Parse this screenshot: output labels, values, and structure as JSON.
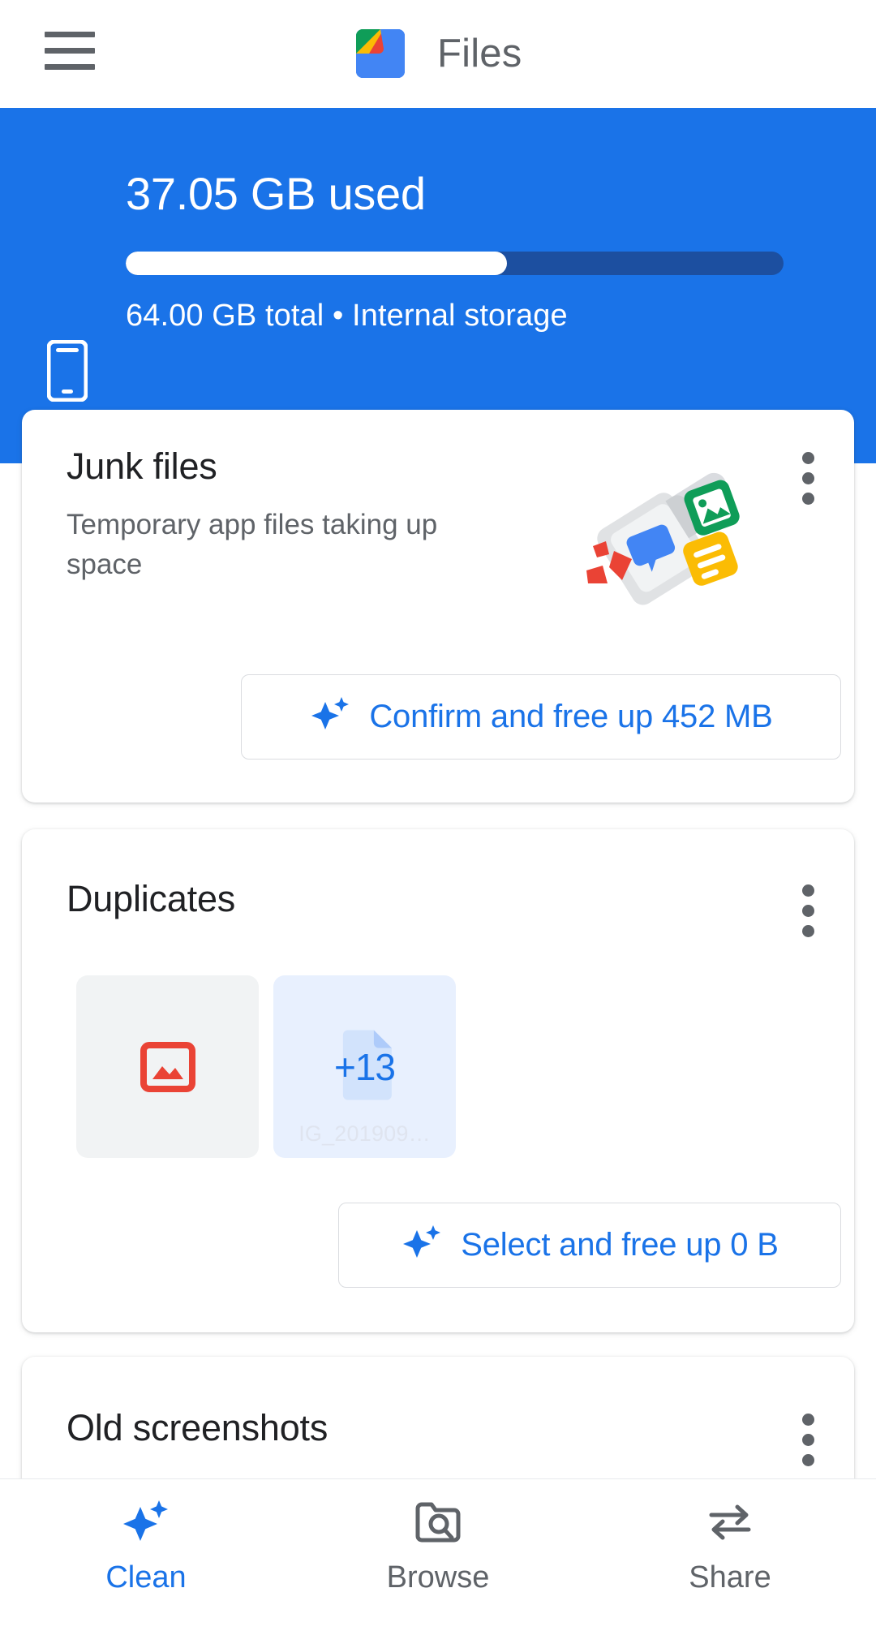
{
  "app": {
    "title": "Files",
    "accent_color": "#1a73e8",
    "banner_color": "#1a73e8",
    "muted_text_color": "#5f6368"
  },
  "appbar": {
    "menu_icon": "hamburger-menu-icon",
    "logo_icon": "files-app-logo-icon",
    "title": "Files"
  },
  "storage": {
    "device_icon": "phone-icon",
    "used_text": "37.05 GB used",
    "total_text": "64.00 GB total • Internal storage",
    "used_gb": 37.05,
    "total_gb": 64.0,
    "percent_used": 57.9
  },
  "cards": [
    {
      "id": "junk-files",
      "title": "Junk files",
      "subtitle": "Temporary app files taking up space",
      "illustration_icon": "junk-files-illustration-icon",
      "overflow_icon": "more-vert-icon",
      "action": {
        "label": "Confirm and free up 452 MB",
        "icon": "sparkle-icon",
        "size": "452 MB"
      }
    },
    {
      "id": "duplicates",
      "title": "Duplicates",
      "overflow_icon": "more-vert-icon",
      "thumbnails": [
        {
          "icon": "image-icon",
          "label": ""
        },
        {
          "icon": "file-icon",
          "count_label": "+13",
          "label": "IG_201909…"
        }
      ],
      "action": {
        "label": "Select and free up 0 B",
        "icon": "sparkle-icon",
        "size": "0 B"
      }
    },
    {
      "id": "old-screenshots",
      "title": "Old screenshots",
      "overflow_icon": "more-vert-icon"
    }
  ],
  "bottom_nav": {
    "active": "Clean",
    "items": [
      {
        "label": "Clean",
        "icon": "sparkle-icon",
        "active": true
      },
      {
        "label": "Browse",
        "icon": "folder-search-icon",
        "active": false
      },
      {
        "label": "Share",
        "icon": "transfer-arrows-icon",
        "active": false
      }
    ]
  }
}
